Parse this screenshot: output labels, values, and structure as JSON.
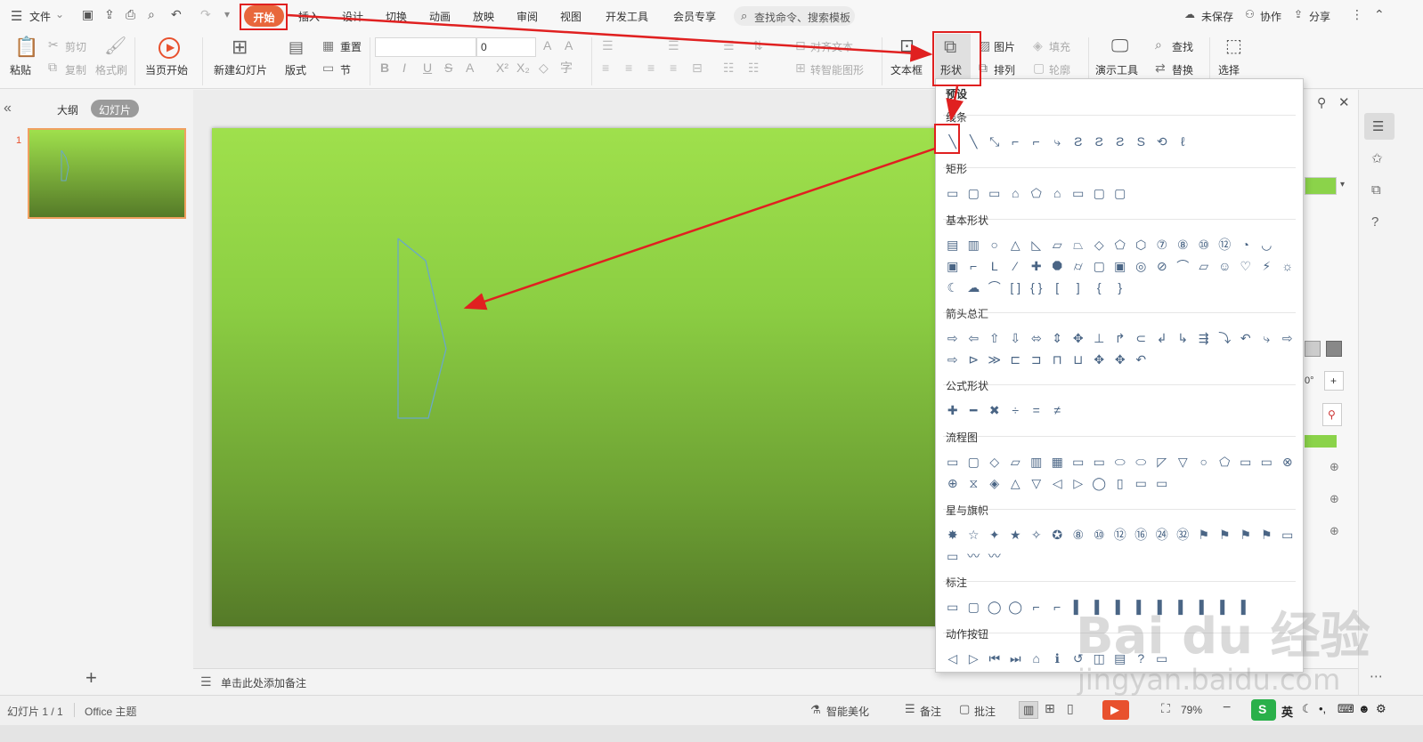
{
  "menubar": {
    "file": "文件",
    "tabs": [
      "开始",
      "插入",
      "设计",
      "切换",
      "动画",
      "放映",
      "审阅",
      "视图",
      "开发工具",
      "会员专享"
    ],
    "active_tab": "开始",
    "search_placeholder": "查找命令、搜索模板",
    "unsaved": "未保存",
    "collab": "协作",
    "share": "分享"
  },
  "ribbon": {
    "paste": "粘贴",
    "cut": "剪切",
    "copy": "复制",
    "format_painter": "格式刷",
    "play_from_current": "当页开始",
    "new_slide": "新建幻灯片",
    "layout": "版式",
    "reset": "重置",
    "section": "节",
    "font_size": "0",
    "align_text": "对齐文本",
    "smart_shape": "转智能图形",
    "textbox": "文本框",
    "shape": "形状",
    "picture": "图片",
    "fill": "填充",
    "arrange": "排列",
    "outline": "轮廓",
    "present_tools": "演示工具",
    "find": "查找",
    "replace": "替换",
    "select": "选择"
  },
  "leftpane": {
    "tab_outline": "大纲",
    "tab_slides": "幻灯片",
    "slide_number": "1"
  },
  "notes_placeholder": "单击此处添加备注",
  "dropdown": {
    "preset": "预设",
    "sections": [
      {
        "title": "线条",
        "rows": [
          [
            "╲",
            "╲",
            "⤡",
            "⌐",
            "⌐",
            "⤷",
            "Ƨ",
            "Ƨ",
            "Ƨ",
            "S",
            "⟲",
            "ℓ"
          ]
        ]
      },
      {
        "title": "矩形",
        "rows": [
          [
            "▭",
            "▢",
            "▭",
            "⌂",
            "⬠",
            "⌂",
            "▭",
            "▢",
            "▢"
          ]
        ]
      },
      {
        "title": "基本形状",
        "rows": [
          [
            "▤",
            "▥",
            "○",
            "△",
            "◺",
            "▱",
            "⏢",
            "◇",
            "⬠",
            "⬡",
            "⑦",
            "⑧",
            "⑩",
            "⑫",
            "◔",
            "◡"
          ],
          [
            "▣",
            "⌐",
            "L",
            "⁄",
            "✚",
            "⯃",
            "⌭",
            "▢",
            "▣",
            "◎",
            "⊘",
            "⌒",
            "▱",
            "☺",
            "♡",
            "⚡",
            "☼"
          ],
          [
            "☾",
            "☁",
            "⌒",
            "[ ]",
            "{ }",
            "[",
            "]",
            "{",
            "}"
          ]
        ]
      },
      {
        "title": "箭头总汇",
        "rows": [
          [
            "⇨",
            "⇦",
            "⇧",
            "⇩",
            "⬄",
            "⇕",
            "✥",
            "⊥",
            "↱",
            "⊂",
            "↲",
            "↳",
            "⇶",
            "⤵",
            "↶",
            "⤷",
            "⇨"
          ],
          [
            "⇨",
            "⊳",
            "≫",
            "⊏",
            "⊐",
            "⊓",
            "⊔",
            "✥",
            "✥",
            "↶"
          ]
        ]
      },
      {
        "title": "公式形状",
        "rows": [
          [
            "✚",
            "━",
            "✖",
            "÷",
            "=",
            "≠"
          ]
        ]
      },
      {
        "title": "流程图",
        "rows": [
          [
            "▭",
            "▢",
            "◇",
            "▱",
            "▥",
            "▦",
            "▭",
            "▭",
            "⬭",
            "⬭",
            "◸",
            "▽",
            "○",
            "⬠",
            "▭",
            "▭",
            "⊗"
          ],
          [
            "⊕",
            "⧖",
            "◈",
            "△",
            "▽",
            "◁",
            "▷",
            "◯",
            "▯",
            "▭",
            "▭"
          ]
        ]
      },
      {
        "title": "星与旗帜",
        "rows": [
          [
            "✸",
            "☆",
            "✦",
            "★",
            "✧",
            "✪",
            "⑧",
            "⑩",
            "⑫",
            "⑯",
            "㉔",
            "㉜",
            "⚑",
            "⚑",
            "⚑",
            "⚑",
            "▭"
          ],
          [
            "▭",
            "〰",
            "〰"
          ]
        ]
      },
      {
        "title": "标注",
        "rows": [
          [
            "▭",
            "▢",
            "◯",
            "◯",
            "⌐",
            "⌐",
            "▌",
            "▌",
            "▌",
            "▌",
            "▌",
            "▌",
            "▌",
            "▌",
            "▌"
          ]
        ]
      },
      {
        "title": "动作按钮",
        "rows": [
          [
            "◁",
            "▷",
            "⏮",
            "⏭",
            "⌂",
            "ℹ",
            "↺",
            "◫",
            "▤",
            "?",
            "▭"
          ]
        ]
      }
    ]
  },
  "statusbar": {
    "slide_info": "幻灯片 1 / 1",
    "theme": "Office 主题",
    "beautify": "智能美化",
    "notes": "备注",
    "comments": "批注",
    "zoom": "79%",
    "ime": "英"
  },
  "watermark": {
    "logo": "Bai du 经验",
    "url": "jingyan.baidu.com"
  },
  "colors": {
    "active_tab": "#e8673c",
    "annotation_red": "#e02020",
    "slide_green_top": "#9fe04c",
    "slide_green_bottom": "#557a28",
    "play_button": "#e8512e"
  }
}
